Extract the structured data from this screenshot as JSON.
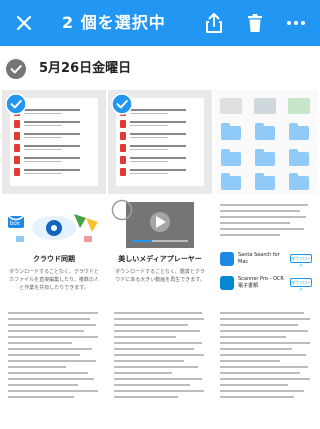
{
  "header": {
    "title": "2 個を選択中",
    "bg_color": "#2196f3"
  },
  "section": {
    "date_label": "5月26日金曜日"
  },
  "tiles": {
    "docs_header": "…",
    "promo_cloud": {
      "caption": "クラウド同期",
      "description": "ダウンロードすることなく、クラウドとカファイルを直接編集したり、複数の人と作業を共有したりできます。"
    },
    "promo_media": {
      "caption": "美しいメディアプレーヤー",
      "description": "ダウンロードすることなく、鑑賞とクラウドにある大きい動画を再生できます。"
    },
    "apps": [
      {
        "name": "Santa Search for Mac",
        "button": "ダウンロード"
      },
      {
        "name": "Scanner Pro - OCR 電子書類",
        "button": "ダウンロード"
      }
    ]
  },
  "colors": {
    "accent": "#2196f3",
    "pdf_red": "#e53935",
    "folder_blue": "#90caf9"
  }
}
